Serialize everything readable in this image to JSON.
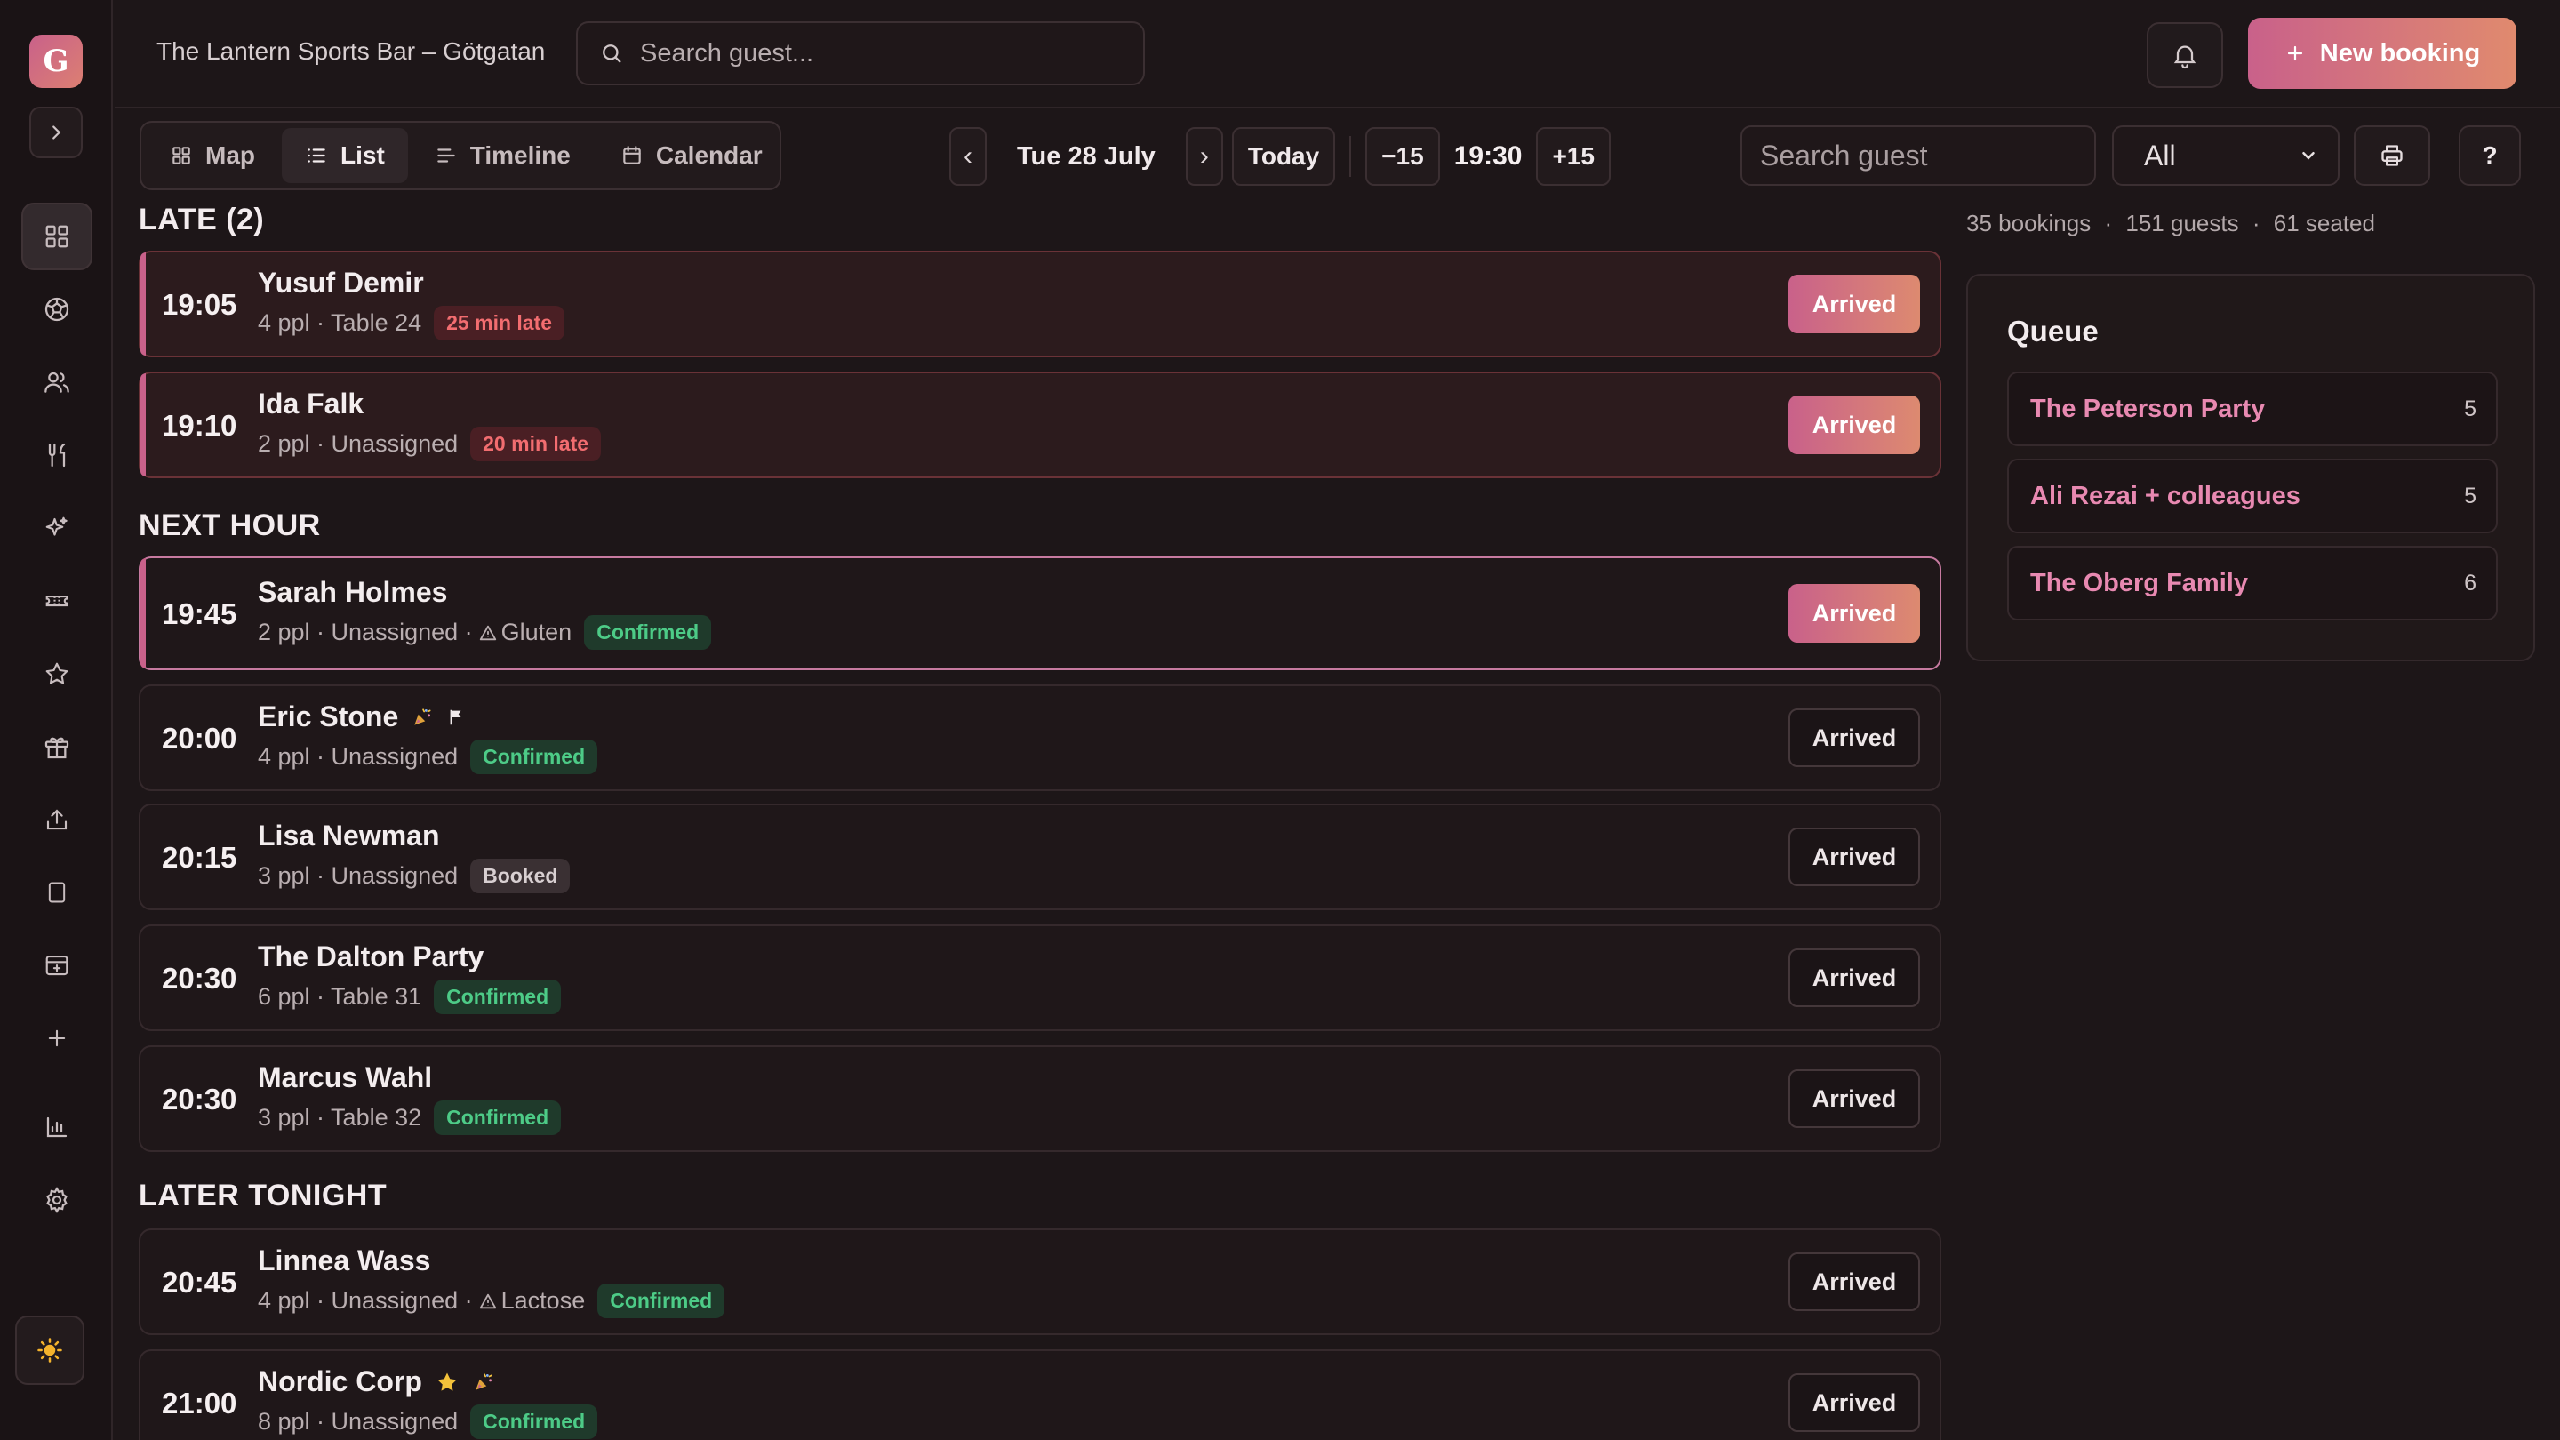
{
  "sidebar": {
    "logo_letter": "G",
    "nav_icons": [
      "grid-icon",
      "ball-icon",
      "users-icon",
      "utensils-icon",
      "sparkle-icon",
      "ticket-icon",
      "star-icon",
      "gift-icon",
      "upload-icon",
      "tablet-icon",
      "layout-add-icon",
      "plus-icon",
      "chart-icon",
      "settings-icon"
    ],
    "active_icon": "grid-icon",
    "theme_icon": "sun-icon"
  },
  "header": {
    "venue": "The Lantern Sports Bar – Götgatan",
    "search_placeholder": "Search guest...",
    "new_booking_label": "New booking"
  },
  "toolbar": {
    "tabs": [
      {
        "label": "Map",
        "icon": "map-grid-icon"
      },
      {
        "label": "List",
        "icon": "list-icon",
        "active": true
      },
      {
        "label": "Timeline",
        "icon": "timeline-icon"
      },
      {
        "label": "Calendar",
        "icon": "calendar-icon"
      }
    ],
    "prev_label": "‹",
    "next_label": "›",
    "date": "Tue 28 July",
    "today_label": "Today",
    "minus_label": "−15",
    "time": "19:30",
    "plus_label": "+15",
    "guest_search_placeholder": "Search guest",
    "filter_value": "All",
    "help_label": "?"
  },
  "summary": {
    "bookings": "35 bookings",
    "guests": "151 guests",
    "seated": "61 seated",
    "separator": "·"
  },
  "sections": {
    "late": "LATE (2)",
    "next_hour": "NEXT HOUR",
    "later": "LATER TONIGHT"
  },
  "arrived_label": "Arrived",
  "bookings": [
    {
      "time": "19:05",
      "name": "Yusuf Demir",
      "meta": "4 ppl · Table 24",
      "badge": "25 min late"
    },
    {
      "time": "19:10",
      "name": "Ida Falk",
      "meta": "2 ppl · Unassigned",
      "badge": "20 min late"
    },
    {
      "time": "19:45",
      "name": "Sarah Holmes",
      "meta": "2 ppl · Unassigned ·",
      "allergy": "Gluten",
      "badge": "Confirmed"
    },
    {
      "time": "20:00",
      "name": "Eric Stone",
      "meta": "4 ppl · Unassigned",
      "badge": "Confirmed",
      "icons": [
        "party-icon",
        "flag-icon"
      ]
    },
    {
      "time": "20:15",
      "name": "Lisa Newman",
      "meta": "3 ppl · Unassigned",
      "badge": "Booked"
    },
    {
      "time": "20:30",
      "name": "The Dalton Party",
      "meta": "6 ppl · Table 31",
      "badge": "Confirmed"
    },
    {
      "time": "20:30",
      "name": "Marcus Wahl",
      "meta": "3 ppl · Table 32",
      "badge": "Confirmed"
    },
    {
      "time": "20:45",
      "name": "Linnea Wass",
      "meta": "4 ppl · Unassigned ·",
      "allergy": "Lactose",
      "badge": "Confirmed"
    },
    {
      "time": "21:00",
      "name": "Nordic Corp",
      "meta": "8 ppl · Unassigned",
      "badge": "Confirmed",
      "icons": [
        "star-icon",
        "party-icon"
      ]
    }
  ],
  "queue": {
    "title": "Queue",
    "items": [
      {
        "name": "The Peterson Party",
        "count": "5"
      },
      {
        "name": "Ali Rezai + colleagues",
        "count": "5"
      },
      {
        "name": "The Oberg Family",
        "count": "6"
      }
    ]
  },
  "colors": {
    "accent_start": "#c9618a",
    "accent_end": "#e08a6e",
    "confirmed": "#4dcb87",
    "late": "#f26d70",
    "background": "#1d1618"
  }
}
